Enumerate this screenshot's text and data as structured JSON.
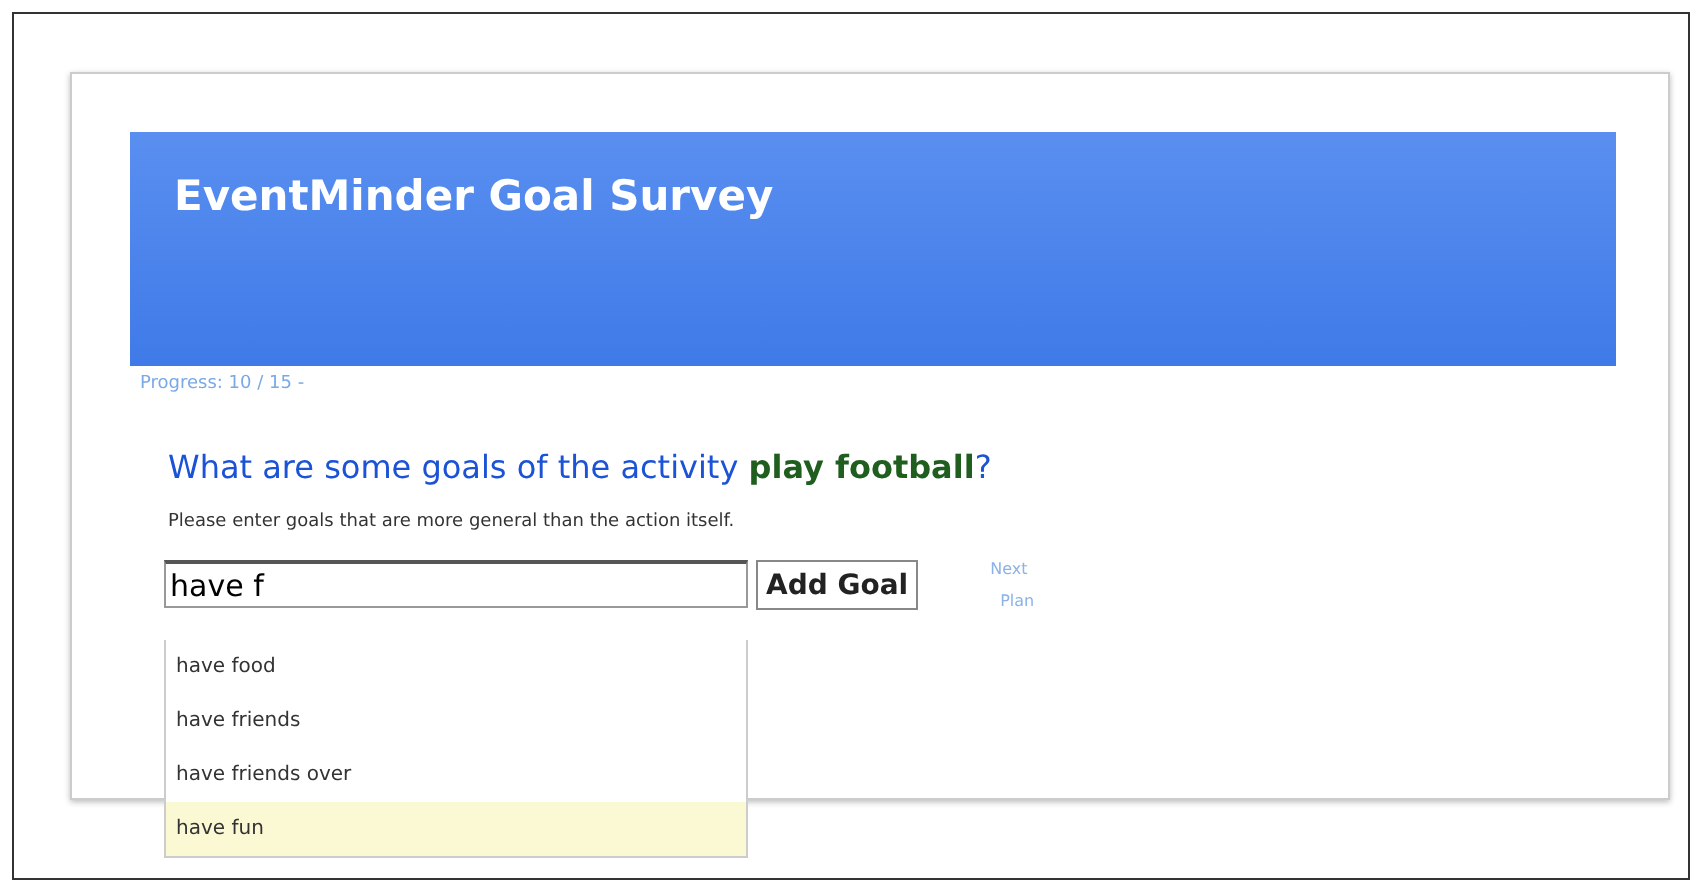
{
  "header": {
    "title": "EventMinder Goal Survey"
  },
  "progress": "Progress: 10 / 15 -",
  "question": "What are some goals of the activity **play football**?",
  "instruction": "Please enter goals that are more general than the action itself.",
  "goal_field": {
    "value": "have f"
  },
  "add_button": "Add Goal",
  "side_links": [
    "Next",
    "Plan"
  ],
  "suggestions": [
    {
      "label": "have food",
      "selected": false
    },
    {
      "label": "have friends",
      "selected": false
    },
    {
      "label": "have friends over",
      "selected": false
    },
    {
      "label": "have fun",
      "selected": true
    }
  ]
}
